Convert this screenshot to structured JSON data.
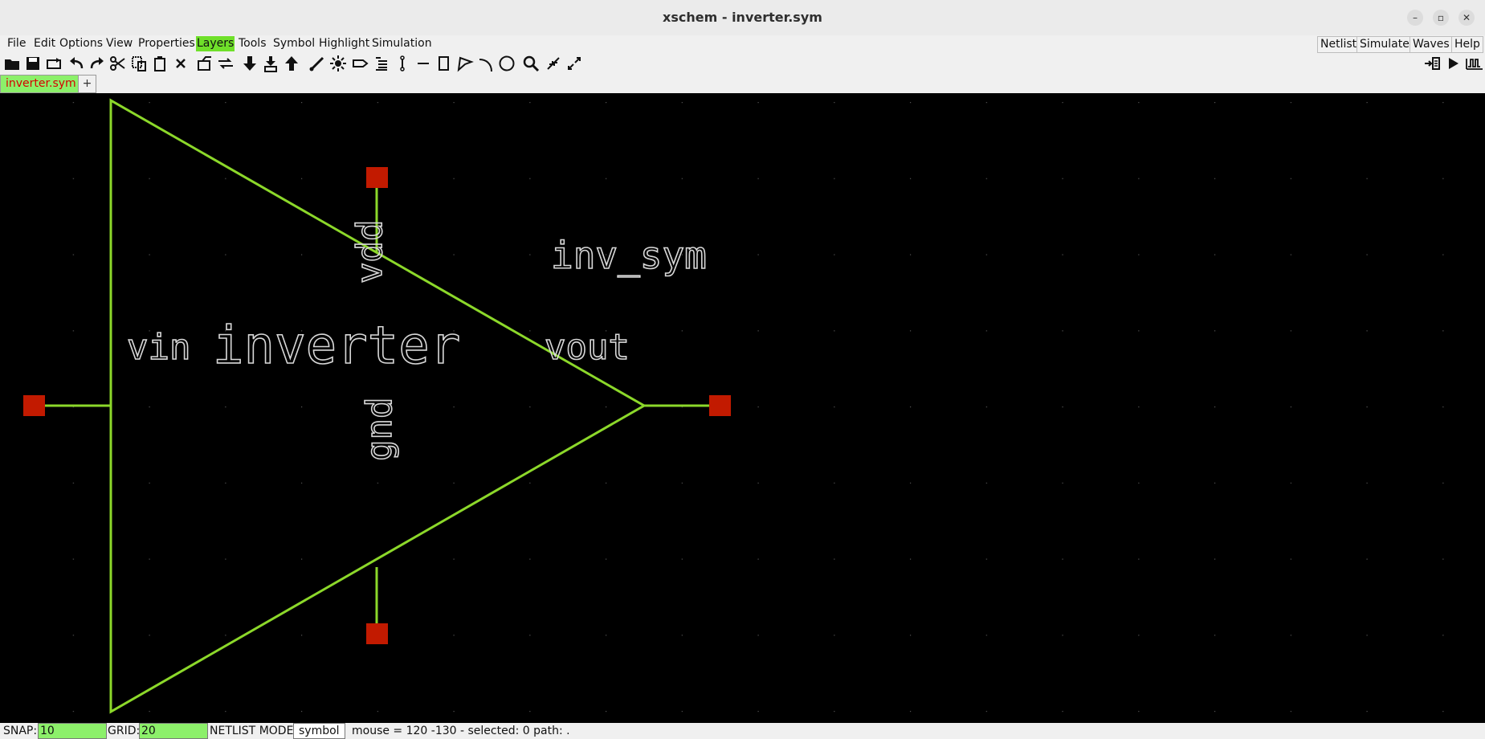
{
  "window": {
    "title": "xschem - inverter.sym",
    "minimize": "–",
    "maximize": "▫",
    "close": "✕"
  },
  "menubar": {
    "items": [
      "File",
      "Edit",
      "Options",
      "View",
      "Properties",
      "Layers",
      "Tools",
      "Symbol",
      "Highlight",
      "Simulation"
    ],
    "active": "Layers",
    "right_items": [
      "Netlist",
      "Simulate",
      "Waves",
      "Help"
    ]
  },
  "toolbar": {
    "icons": [
      "open-icon",
      "save-icon",
      "reload-icon",
      "undo-icon",
      "redo-icon",
      "cut-icon",
      "copy-icon",
      "paste-icon",
      "delete-icon",
      "push-icon",
      "move-icon",
      "descend-icon",
      "symbol-icon",
      "ascend-icon",
      "wire-icon",
      "highlight-icon",
      "pin-icon",
      "text-icon",
      "net-label-icon",
      "line-icon",
      "rect-icon",
      "polygon-icon",
      "arc-icon",
      "circle-icon",
      "zoom-icon",
      "zoom-in-icon",
      "zoom-full-icon",
      "netlist-icon",
      "simulate-icon",
      "waves-icon"
    ]
  },
  "tabs": {
    "items": [
      "inverter.sym"
    ],
    "add_label": "+"
  },
  "symbol": {
    "name_label": "inv_sym",
    "type_label": "inverter",
    "pins": [
      "vin",
      "vout",
      "vdd",
      "gnd"
    ],
    "line_color": "#8cd82a",
    "pin_color": "#c21a00",
    "text_color": "#d8d8d8"
  },
  "status": {
    "snap_label": "SNAP:",
    "snap_value": "10",
    "grid_label": "GRID:",
    "grid_value": "20",
    "netlist_mode_label": "NETLIST MODE:",
    "netlist_mode_value": "symbol",
    "info": "mouse = 120 -130 - selected: 0 path: ."
  }
}
